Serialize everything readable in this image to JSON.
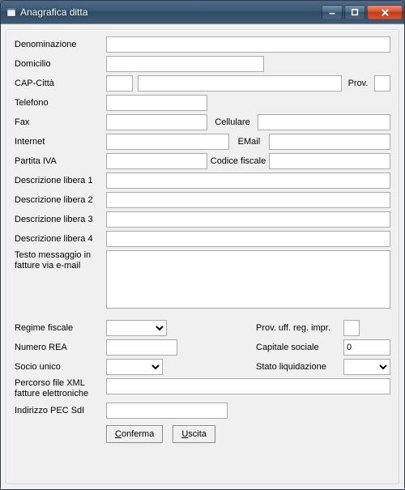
{
  "window": {
    "title": "Anagrafica ditta"
  },
  "labels": {
    "denominazione": "Denominazione",
    "domicilio": "Domicilio",
    "cap_citta": "CAP-Città",
    "prov": "Prov.",
    "telefono": "Telefono",
    "fax": "Fax",
    "cellulare": "Cellulare",
    "internet": "Internet",
    "email": "EMail",
    "partita_iva": "Partita IVA",
    "codice_fiscale": "Codice fiscale",
    "descr1": "Descrizione libera 1",
    "descr2": "Descrizione libera 2",
    "descr3": "Descrizione libera 3",
    "descr4": "Descrizione libera 4",
    "testo_msg": "Testo messaggio in fatture via e-mail",
    "regime_fiscale": "Regime fiscale",
    "prov_uff": "Prov. uff. reg. impr.",
    "numero_rea": "Numero REA",
    "capitale_sociale": "Capitale sociale",
    "socio_unico": "Socio unico",
    "stato_liquidazione": "Stato liquidazione",
    "percorso_xml": "Percorso file XML fatture elettroniche",
    "indirizzo_pec": "Indirizzo PEC SdI"
  },
  "values": {
    "denominazione": "",
    "domicilio": "",
    "cap": "",
    "citta": "",
    "prov": "",
    "telefono": "",
    "fax": "",
    "cellulare": "",
    "internet": "",
    "email": "",
    "partita_iva": "",
    "codice_fiscale": "",
    "descr1": "",
    "descr2": "",
    "descr3": "",
    "descr4": "",
    "testo_msg": "",
    "regime_fiscale": "",
    "prov_uff": "",
    "numero_rea": "",
    "capitale_sociale": "0",
    "socio_unico": "",
    "stato_liquidazione": "",
    "percorso_xml": "",
    "indirizzo_pec": ""
  },
  "buttons": {
    "confirm": "Conferma",
    "exit": "Uscita"
  }
}
